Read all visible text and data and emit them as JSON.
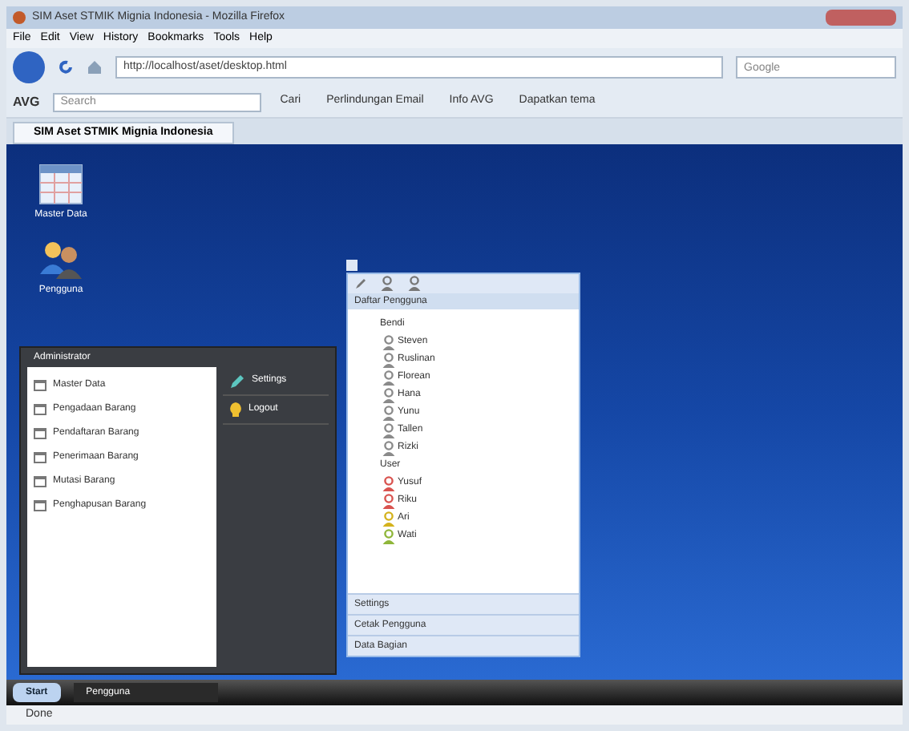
{
  "window": {
    "title": "SIM Aset STMIK Mignia Indonesia - Mozilla Firefox"
  },
  "menu": [
    "File",
    "Edit",
    "View",
    "History",
    "Bookmarks",
    "Tools",
    "Help"
  ],
  "address": {
    "value": "http://localhost/aset/desktop.html"
  },
  "search": {
    "placeholder": "Google"
  },
  "avg_toolbar": {
    "brand": "AVG",
    "search_placeholder": "Search",
    "buttons": [
      "Cari",
      "Perlindungan Email",
      "Info AVG",
      "Dapatkan tema"
    ]
  },
  "tabs": [
    {
      "label": "SIM Aset STMIK Mignia Indonesia",
      "selected": true
    }
  ],
  "desktop_icons": [
    {
      "label": "Master Data",
      "kind": "table"
    },
    {
      "label": "Pengguna",
      "kind": "users"
    }
  ],
  "start_menu": {
    "title": "Administrator",
    "items": [
      "Master Data",
      "Pengadaan Barang",
      "Pendaftaran Barang",
      "Penerimaan Barang",
      "Mutasi Barang",
      "Penghapusan Barang"
    ],
    "actions": [
      {
        "label": "Settings",
        "kind": "settings"
      },
      {
        "label": "Logout",
        "kind": "logout"
      }
    ]
  },
  "user_window": {
    "panel_title": "Daftar Pengguna",
    "groups": [
      {
        "label": "Bendi",
        "children": [
          {
            "label": "Steven",
            "color": "#8a8a8a"
          },
          {
            "label": "Ruslinan",
            "color": "#8a8a8a"
          },
          {
            "label": "Florean",
            "color": "#8a8a8a"
          },
          {
            "label": "Hana",
            "color": "#8a8a8a"
          },
          {
            "label": "Yunu",
            "color": "#8a8a8a"
          },
          {
            "label": "Tallen",
            "color": "#8a8a8a"
          },
          {
            "label": "Rizki",
            "color": "#8a8a8a"
          }
        ]
      },
      {
        "label": "User",
        "children": [
          {
            "label": "Yusuf",
            "color": "#d9534f"
          },
          {
            "label": "Riku",
            "color": "#d9534f"
          },
          {
            "label": "Ari",
            "color": "#d4b21c"
          },
          {
            "label": "Wati",
            "color": "#8fb63a"
          }
        ]
      }
    ],
    "sections": [
      "Settings",
      "Cetak Pengguna",
      "Data Bagian"
    ]
  },
  "taskbar": {
    "start": "Start",
    "windows": [
      {
        "label": "Pengguna",
        "selected": true
      }
    ]
  },
  "status_bar": "Done"
}
